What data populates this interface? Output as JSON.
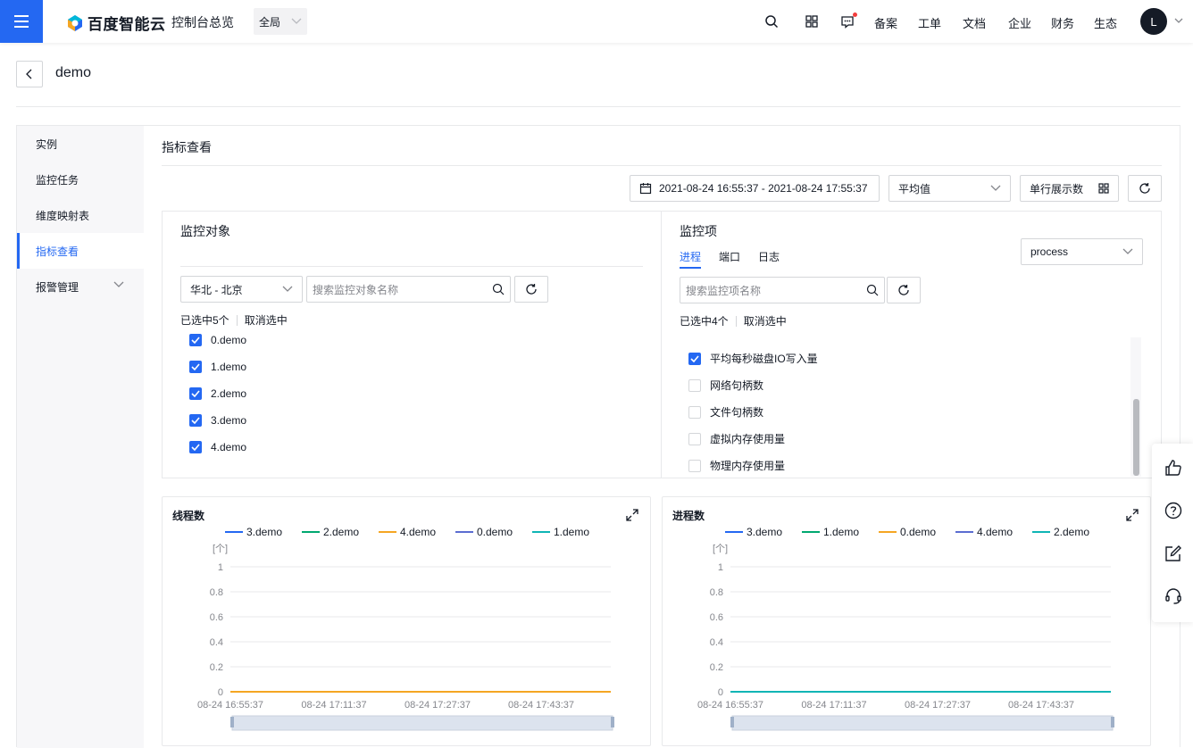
{
  "topbar": {
    "brand": "百度智能云",
    "console_title": "控制台总览",
    "region": "全局",
    "links": [
      "备案",
      "工单",
      "文档",
      "企业",
      "财务",
      "生态"
    ],
    "avatar_letter": "L"
  },
  "page": {
    "title": "demo"
  },
  "sidebar": {
    "items": [
      {
        "label": "实例"
      },
      {
        "label": "监控任务"
      },
      {
        "label": "维度映射表"
      },
      {
        "label": "指标查看"
      },
      {
        "label": "报警管理"
      }
    ]
  },
  "main": {
    "section_title": "指标查看",
    "date_range": "2021-08-24 16:55:37 - 2021-08-24 17:55:37",
    "stat_select": "平均值",
    "per_row_label": "单行展示数"
  },
  "object_panel": {
    "title": "监控对象",
    "region_select": "华北 - 北京",
    "search_placeholder": "搜索监控对象名称",
    "selected_text": "已选中5个",
    "clear_text": "取消选中",
    "items": [
      {
        "label": "0.demo",
        "checked": true
      },
      {
        "label": "1.demo",
        "checked": true
      },
      {
        "label": "2.demo",
        "checked": true
      },
      {
        "label": "3.demo",
        "checked": true
      },
      {
        "label": "4.demo",
        "checked": true
      }
    ]
  },
  "metric_panel": {
    "title": "监控项",
    "tabs": [
      "进程",
      "端口",
      "日志"
    ],
    "type_select": "process",
    "search_placeholder": "搜索监控项名称",
    "selected_text": "已选中4个",
    "clear_text": "取消选中",
    "items": [
      {
        "label": "平均每秒磁盘IO写入量",
        "checked": true
      },
      {
        "label": "网络句柄数",
        "checked": false
      },
      {
        "label": "文件句柄数",
        "checked": false
      },
      {
        "label": "虚拟内存使用量",
        "checked": false
      },
      {
        "label": "物理内存使用量",
        "checked": false
      }
    ]
  },
  "colors": {
    "accent": "#2468f2",
    "series": [
      "#2468f2",
      "#00a870",
      "#f5a623",
      "#5b6dd1",
      "#0fb5b5"
    ]
  },
  "chart_data": [
    {
      "type": "line",
      "title": "线程数",
      "ylabel": "[个]",
      "ylim": [
        0,
        1
      ],
      "yticks": [
        "1",
        "0.8",
        "0.6",
        "0.4",
        "0.2",
        "0"
      ],
      "x": [
        "08-24 16:55:37",
        "08-24 17:11:37",
        "08-24 17:27:37",
        "08-24 17:43:37"
      ],
      "series": [
        {
          "name": "3.demo",
          "values": [
            0,
            0,
            0,
            0
          ]
        },
        {
          "name": "2.demo",
          "values": [
            0,
            0,
            0,
            0
          ]
        },
        {
          "name": "4.demo",
          "values": [
            0,
            0,
            0,
            0
          ]
        },
        {
          "name": "0.demo",
          "values": [
            0,
            0,
            0,
            0
          ]
        },
        {
          "name": "1.demo",
          "values": [
            0,
            0,
            0,
            0
          ]
        }
      ],
      "legend_colors": [
        "#2468f2",
        "#00a870",
        "#f5a623",
        "#5b6dd1",
        "#0fb5b5"
      ],
      "visible_line_color": "#f5a623"
    },
    {
      "type": "line",
      "title": "进程数",
      "ylabel": "[个]",
      "ylim": [
        0,
        1
      ],
      "yticks": [
        "1",
        "0.8",
        "0.6",
        "0.4",
        "0.2",
        "0"
      ],
      "x": [
        "08-24 16:55:37",
        "08-24 17:11:37",
        "08-24 17:27:37",
        "08-24 17:43:37"
      ],
      "series": [
        {
          "name": "3.demo",
          "values": [
            0,
            0,
            0,
            0
          ]
        },
        {
          "name": "1.demo",
          "values": [
            0,
            0,
            0,
            0
          ]
        },
        {
          "name": "0.demo",
          "values": [
            0,
            0,
            0,
            0
          ]
        },
        {
          "name": "4.demo",
          "values": [
            0,
            0,
            0,
            0
          ]
        },
        {
          "name": "2.demo",
          "values": [
            0,
            0,
            0,
            0
          ]
        }
      ],
      "legend_colors": [
        "#2468f2",
        "#00a870",
        "#f5a623",
        "#5b6dd1",
        "#0fb5b5"
      ],
      "visible_line_color": "#0fb5b5"
    }
  ]
}
